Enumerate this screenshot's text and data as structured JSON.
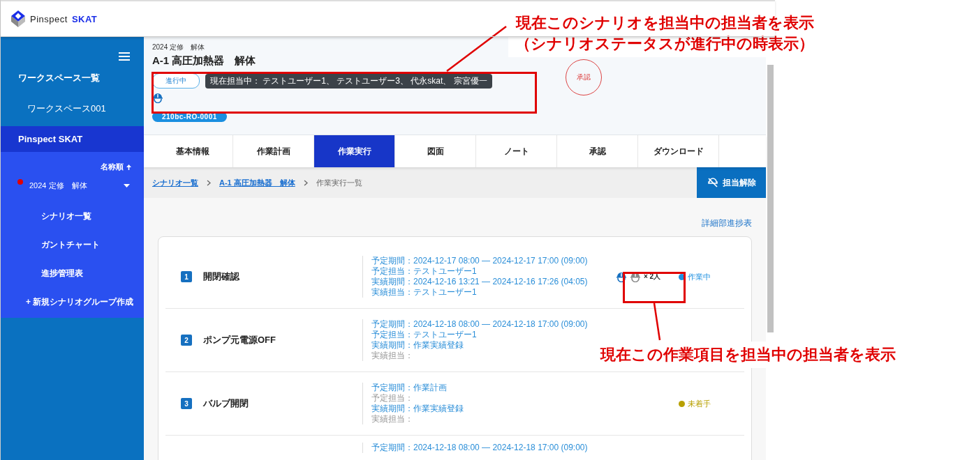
{
  "header": {
    "logo_text": "Pinspect",
    "logo_brand": "SKAT"
  },
  "sidebar": {
    "workspace_heading": "ワークスペース一覧",
    "workspace": "ワークスペース001",
    "project": {
      "label": "Pinspect SKAT",
      "selected": true
    },
    "sort_label": "名称順",
    "group": {
      "label": "2024 定修　解体",
      "color": "#e00000",
      "expanded": true,
      "children": [
        {
          "label": "シナリオ一覧"
        },
        {
          "label": "ガントチャート"
        },
        {
          "label": "進捗管理表"
        }
      ]
    },
    "add_label": "+ 新規シナリオグループ作成"
  },
  "scenario": {
    "group": "2024 定修　解体",
    "title": "A-1 高圧加熱器　解体",
    "status": "進行中",
    "assignees_tooltip": "現在担当中： テストユーザー1、 テストユーザー3、 代永skat、 宗宮優一",
    "code": "210bc-RO-0001",
    "stamp": "承認"
  },
  "tabs": [
    {
      "label": "基本情報",
      "selected": false
    },
    {
      "label": "作業計画",
      "selected": false
    },
    {
      "label": "作業実行",
      "selected": true
    },
    {
      "label": "図面",
      "selected": false
    },
    {
      "label": "ノート",
      "selected": false
    },
    {
      "label": "承認",
      "selected": false
    },
    {
      "label": "ダウンロード",
      "selected": false
    }
  ],
  "breadcrumb": [
    {
      "label": "シナリオ一覧",
      "link": true
    },
    {
      "label": "A-1 高圧加熱器　解体",
      "link": true
    },
    {
      "label": "作業実行一覧",
      "link": false
    }
  ],
  "release_button": "担当解除",
  "progress_link": "詳細部進捗表",
  "tasks": [
    {
      "number": "1",
      "name": "開閉確認",
      "details": [
        {
          "text": "予定期間：2024-12-17 08:00 — 2024-12-17 17:00 (09:00)",
          "filled": true
        },
        {
          "text": "予定担当：テストユーザー1",
          "filled": true
        },
        {
          "text": "実績期間：2024-12-16 13:21 — 2024-12-16 17:26 (04:05)",
          "filled": true
        },
        {
          "text": "実績担当：テストユーザー1",
          "filled": true
        }
      ],
      "assignees": [
        {
          "active": true
        },
        {
          "active": false
        }
      ],
      "assignee_count": "× 2人",
      "status": {
        "label": "作業中",
        "color": "#1e90e0"
      }
    },
    {
      "number": "2",
      "name": "ポンプ元電源OFF",
      "details": [
        {
          "text": "予定期間：2024-12-18 08:00 — 2024-12-18 17:00 (09:00)",
          "filled": true
        },
        {
          "text": "予定担当：テストユーザー1",
          "filled": true
        },
        {
          "text": "実績期間：作業実績登録",
          "filled": true
        },
        {
          "text": "実績担当：",
          "filled": false
        }
      ]
    },
    {
      "number": "3",
      "name": "バルブ開閉",
      "details": [
        {
          "text": "予定期間：作業計画",
          "filled": true
        },
        {
          "text": "予定担当：",
          "filled": false
        },
        {
          "text": "実績期間：作業実績登録",
          "filled": true
        },
        {
          "text": "実績担当：",
          "filled": false
        }
      ],
      "status": {
        "label": "未着手",
        "color": "#b8a000"
      }
    },
    {
      "details": [
        {
          "text": "予定期間：2024-12-18 08:00 — 2024-12-18 17:00 (09:00)",
          "filled": true
        }
      ]
    }
  ],
  "annotations": [
    {
      "lines": [
        "現在このシナリオを担当中の担当者を表示",
        "（シナリオステータスが進行中の時表示）"
      ]
    },
    {
      "lines": [
        "現在この作業項目を担当中の担当者を表示"
      ]
    }
  ]
}
